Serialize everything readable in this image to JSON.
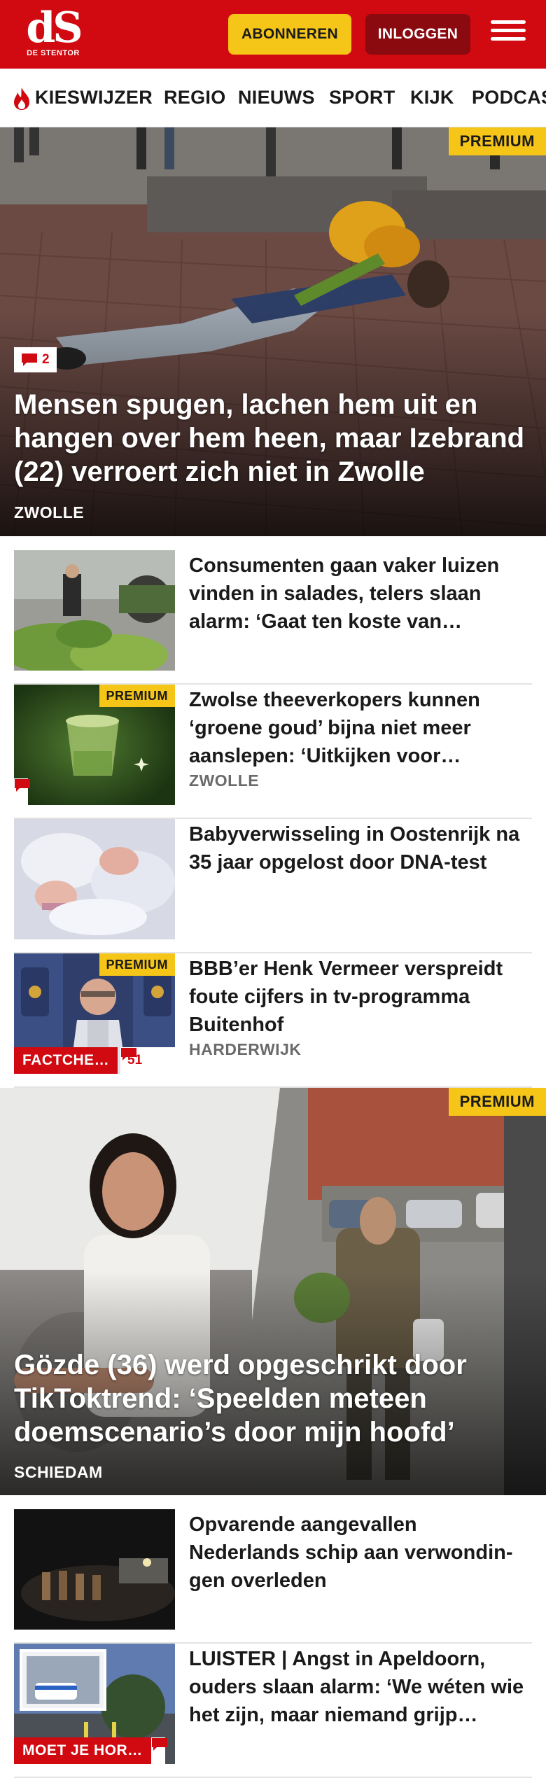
{
  "brand": {
    "logo_text": "dS",
    "logo_sub": "DE STENTOR",
    "red": "#d10a11",
    "yellow": "#f5c518"
  },
  "header": {
    "subscribe_label": "ABONNEREN",
    "login_label": "INLOGGEN",
    "menu_icon": "hamburger-menu-icon"
  },
  "nav": {
    "items": [
      "KIESWIJZER",
      "REGIO",
      "NIEUWS",
      "SPORT",
      "KIJK",
      "PODCAST"
    ],
    "first_item_icon": "flame-icon"
  },
  "hero1": {
    "premium": "PREMIUM",
    "comments": "2",
    "title": "Mensen spugen, lachen hem uit en hangen over hem heen, maar Izebrand (22) verroert zich niet in Zwolle",
    "location": "ZWOLLE"
  },
  "articles": [
    {
      "title": "Consumenten gaan vaker luizen vinden in salades, telers slaan alarm: ‘Gaat ten koste van…",
      "location": ""
    },
    {
      "title": "Zwolse theeverkopers kunnen ‘groene goud’ bijna niet meer aanslepen: ‘Uitkijken voor…",
      "location": "ZWOLLE",
      "premium": "PREMIUM",
      "comments": ""
    },
    {
      "title": "Babyverwisseling in Oostenrijk na 35 jaar opgelost door DNA-test",
      "location": ""
    },
    {
      "title": "BBB’er Henk Vermeer verspreidt foute cijfers in tv-programma Buitenhof",
      "location": "HARDERWIJK",
      "premium": "PREMIUM",
      "tag": "FACTCHE…",
      "comments": "51"
    }
  ],
  "hero2": {
    "premium": "PREMIUM",
    "title": "Gözde (36) werd opgeschrikt door TikToktrend: ‘Speelden meteen doemscenario’s door mijn hoofd’",
    "location": "SCHIEDAM"
  },
  "articles2": [
    {
      "title": "Opvarende aangevallen Nederlands schip aan verwondin­gen overleden",
      "location": ""
    },
    {
      "title": "LUISTER | Angst in Apeldoorn, ouders slaan alarm: ‘We wéten wie het zijn, maar niemand grijp…",
      "location": "",
      "tag": "MOET JE HOR…",
      "comments": ""
    }
  ]
}
